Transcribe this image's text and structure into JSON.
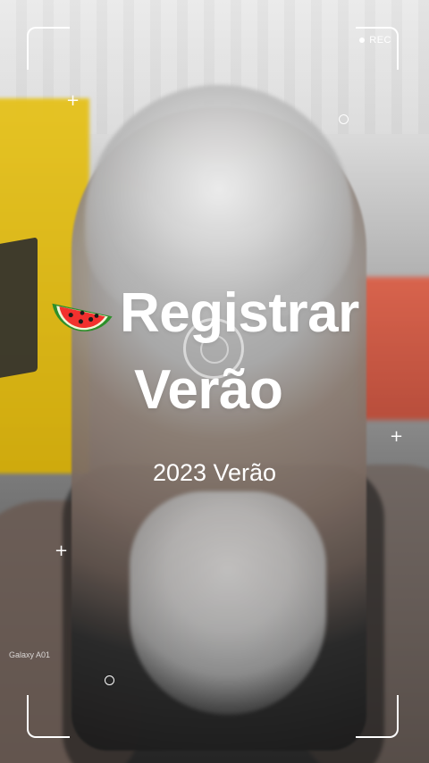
{
  "camera": {
    "recording_label": "REC"
  },
  "overlay": {
    "title_line1": "Registrar",
    "title_line2": "Verão",
    "subtitle": "2023 Verão",
    "background_text": "Galaxy A01"
  },
  "icons": {
    "title_icon": "watermelon-icon"
  }
}
